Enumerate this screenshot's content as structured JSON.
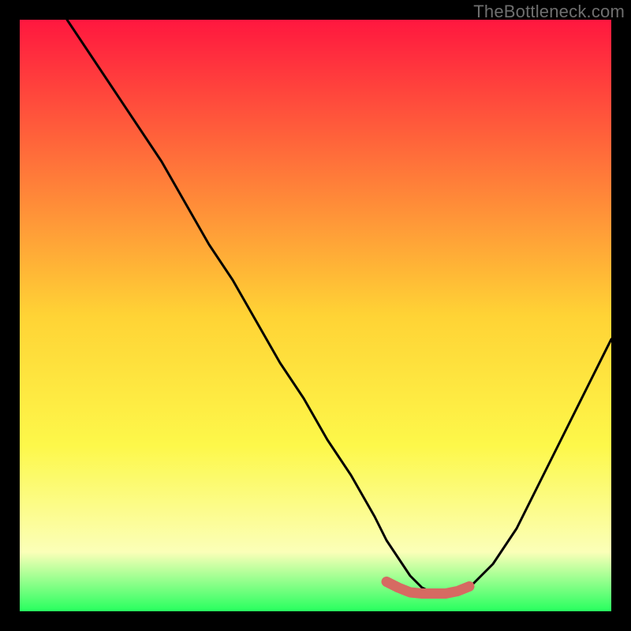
{
  "watermark": "TheBottleneck.com",
  "colors": {
    "background": "#000000",
    "gradient_top": "#ff173f",
    "gradient_mid_upper": "#ff6a3a",
    "gradient_mid": "#ffd335",
    "gradient_mid_lower": "#fdf84a",
    "gradient_lower": "#fbffb8",
    "gradient_bottom": "#27ff5f",
    "curve": "#000000",
    "highlight": "#d66a62",
    "watermark": "#6f6f6f"
  },
  "chart_data": {
    "type": "line",
    "title": "",
    "xlabel": "",
    "ylabel": "",
    "xlim": [
      0,
      100
    ],
    "ylim": [
      0,
      100
    ],
    "series": [
      {
        "name": "bottleneck-curve",
        "x": [
          8,
          12,
          16,
          20,
          24,
          28,
          32,
          36,
          40,
          44,
          48,
          52,
          56,
          60,
          62,
          64,
          66,
          68,
          70,
          72,
          74,
          76,
          80,
          84,
          88,
          92,
          96,
          100
        ],
        "y": [
          100,
          94,
          88,
          82,
          76,
          69,
          62,
          56,
          49,
          42,
          36,
          29,
          23,
          16,
          12,
          9,
          6,
          4,
          3,
          3,
          3,
          4,
          8,
          14,
          22,
          30,
          38,
          46
        ]
      }
    ],
    "highlight_segment": {
      "note": "flat valley segment drawn thicker in muted red",
      "x": [
        62,
        64,
        66,
        68,
        70,
        72,
        74,
        76
      ],
      "y": [
        5,
        4,
        3.2,
        3,
        3,
        3,
        3.4,
        4.2
      ]
    }
  }
}
